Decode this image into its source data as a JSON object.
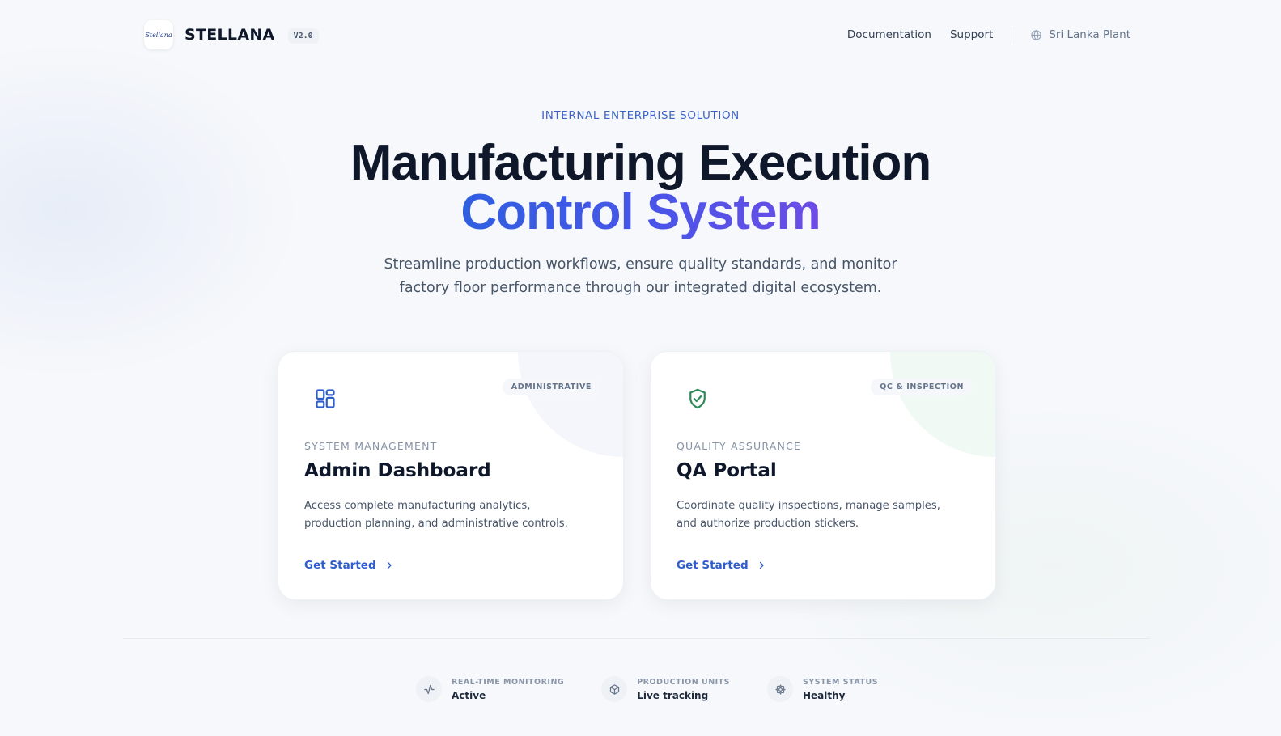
{
  "header": {
    "logo_text": "Stellana",
    "brand_name": "STELLANA",
    "version": "V2.0",
    "nav": [
      {
        "label": "Documentation",
        "icon": "doc"
      },
      {
        "label": "Support",
        "icon": "support"
      }
    ],
    "plant_label": "Sri Lanka Plant",
    "plant_icon": "globe-icon"
  },
  "hero": {
    "eyebrow": "INTERNAL ENTERPRISE SOLUTION",
    "title_line1": "Manufacturing Execution",
    "title_line2": "Control System",
    "subtitle": "Streamline production workflows, ensure quality standards, and monitor factory floor performance through our integrated digital ecosystem."
  },
  "cards": [
    {
      "icon": "grid-dashboard-icon",
      "tag": "ADMINISTRATIVE",
      "kicker": "SYSTEM MANAGEMENT",
      "title": "Admin Dashboard",
      "description": "Access complete manufacturing analytics, production planning, and administrative controls.",
      "cta": "Get Started",
      "accent": "#2f5dcc"
    },
    {
      "icon": "shield-check-icon",
      "tag": "QC & INSPECTION",
      "kicker": "QUALITY ASSURANCE",
      "title": "QA Portal",
      "description": "Coordinate quality inspections, manage samples, and authorize production stickers.",
      "cta": "Get Started",
      "accent": "#2f8a5a"
    }
  ],
  "stats": [
    {
      "icon": "activity-icon",
      "label": "REAL-TIME MONITORING",
      "value": "Active"
    },
    {
      "icon": "box-icon",
      "label": "PRODUCTION UNITS",
      "value": "Live tracking"
    },
    {
      "icon": "gear-icon",
      "label": "SYSTEM STATUS",
      "value": "Healthy"
    }
  ],
  "colors": {
    "primary": "#2f5dcc",
    "accent_gradient_start": "#2f5fe0",
    "accent_gradient_end": "#6d4ce6",
    "success": "#2f8a5a",
    "background": "#f6f8fb"
  }
}
